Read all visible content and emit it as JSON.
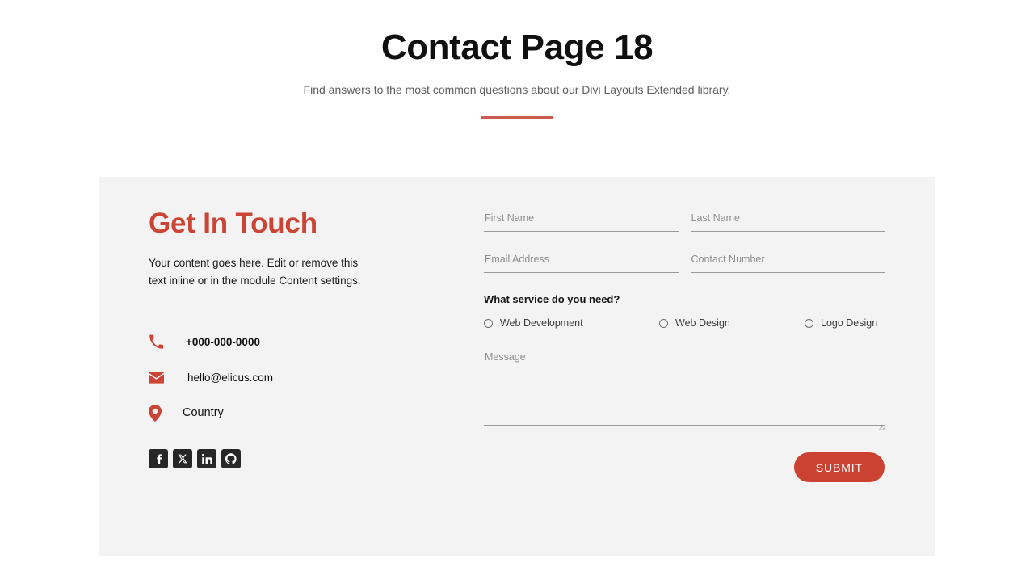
{
  "header": {
    "title": "Contact Page 18",
    "subtitle": "Find answers to the most common questions about our Divi Layouts Extended library.",
    "divider_color": "#cc5a51"
  },
  "panel": {
    "background": "#f3f3f3",
    "left": {
      "heading": "Get In Touch",
      "heading_color": "#cc4534",
      "intro": "Your content goes here. Edit or remove this text inline or in the module Content settings.",
      "contacts": [
        {
          "icon": "phone-icon",
          "value": "+000-000-0000"
        },
        {
          "icon": "envelope-icon",
          "value": "hello@elicus.com"
        },
        {
          "icon": "map-pin-icon",
          "value": "Country"
        }
      ],
      "social": [
        {
          "icon": "facebook-icon",
          "label": "Facebook"
        },
        {
          "icon": "x-twitter-icon",
          "label": "X"
        },
        {
          "icon": "linkedin-icon",
          "label": "LinkedIn"
        },
        {
          "icon": "github-icon",
          "label": "GitHub"
        }
      ],
      "social_tile_color": "#272727"
    },
    "form": {
      "first_name": {
        "placeholder": "First Name",
        "value": ""
      },
      "last_name": {
        "placeholder": "Last Name",
        "value": ""
      },
      "email": {
        "placeholder": "Email Address",
        "value": ""
      },
      "contact_number": {
        "placeholder": "Contact Number",
        "value": ""
      },
      "service_question": "What service do you need?",
      "service_options": [
        {
          "label": "Web Development",
          "selected": false
        },
        {
          "label": "Web Design",
          "selected": false
        },
        {
          "label": "Logo Design",
          "selected": false
        }
      ],
      "message": {
        "placeholder": "Message",
        "value": ""
      },
      "submit_label": "SUBMIT",
      "submit_color": "#cc4232"
    }
  }
}
